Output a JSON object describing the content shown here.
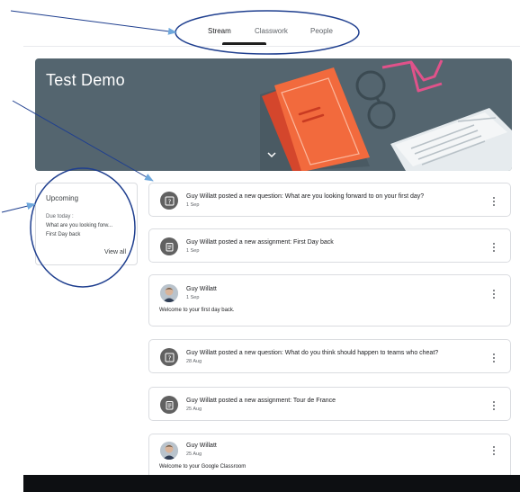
{
  "nav": {
    "tabs": [
      {
        "label": "Stream",
        "active": true
      },
      {
        "label": "Classwork",
        "active": false
      },
      {
        "label": "People",
        "active": false
      }
    ]
  },
  "banner": {
    "title": "Test Demo"
  },
  "upcoming": {
    "title": "Upcoming",
    "due": "Due today :",
    "items": [
      "What are you looking forw...",
      "First Day back"
    ],
    "view_all": "View all"
  },
  "posts": [
    {
      "kind": "question",
      "title": "Guy Willatt posted a new question: What are you looking forward to on your first day?",
      "date": "1 Sep"
    },
    {
      "kind": "assignment",
      "title": "Guy Willatt posted a new assignment: First Day back",
      "date": "1 Sep"
    },
    {
      "kind": "announcement",
      "title": "Guy Willatt",
      "date": "1 Sep",
      "body": "Welcome to your first day back."
    },
    {
      "kind": "question",
      "title": "Guy Willatt posted a new question: What do you think should happen to teams who cheat?",
      "date": "28 Aug"
    },
    {
      "kind": "assignment",
      "title": "Guy Willatt posted a new assignment: Tour de France",
      "date": "25 Aug"
    },
    {
      "kind": "announcement",
      "title": "Guy Willatt",
      "date": "25 Aug",
      "body": "Welcome to your Google Classroom"
    }
  ],
  "colors": {
    "banner_bg": "#54656f",
    "annotation_blue": "#1f3f8f",
    "icon_grey": "#616161"
  }
}
